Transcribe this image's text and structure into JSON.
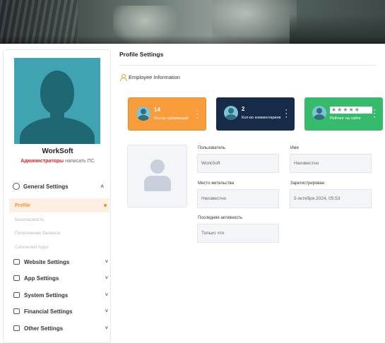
{
  "sidebar": {
    "username": "WorkSoft",
    "role_highlight": "Администраторы",
    "role_rest": " написать ПС",
    "general_settings": "General Settings",
    "active_item": "Profile",
    "subitems": [
      "Безопасность",
      "Пополнение баланса",
      "Connected Apps"
    ],
    "nav": [
      {
        "label": "Website Settings",
        "icon": "monitor-icon"
      },
      {
        "label": "App Settings",
        "icon": "app-icon"
      },
      {
        "label": "System Settings",
        "icon": "system-icon"
      },
      {
        "label": "Financial Settings",
        "icon": "finance-icon"
      },
      {
        "label": "Other Settings",
        "icon": "other-icon"
      }
    ]
  },
  "main": {
    "title": "Profile Settings",
    "section": "Employee Information",
    "cards": [
      {
        "number": "14",
        "label": "Кол-во публикаций"
      },
      {
        "number": "2",
        "label": "Кол-во комментариев"
      },
      {
        "stars": "★★★★★",
        "label": "Рейтинг на сайте"
      }
    ],
    "fields": [
      {
        "label": "Пользователь",
        "value": "WorkSoft"
      },
      {
        "label": "Имя",
        "value": "Неизвестно"
      },
      {
        "label": "Место жительства",
        "value": "Неизвестно"
      },
      {
        "label": "Зарегистрирован",
        "value": "5 октября 2024, 05:53"
      },
      {
        "label": "Последняя активность",
        "value": "Только что"
      }
    ]
  },
  "colors": {
    "accent": "#f0902f",
    "card_orange": "#f89c3c",
    "card_navy": "#152b47",
    "card_green": "#35bb6a",
    "role_red": "#d62424"
  }
}
